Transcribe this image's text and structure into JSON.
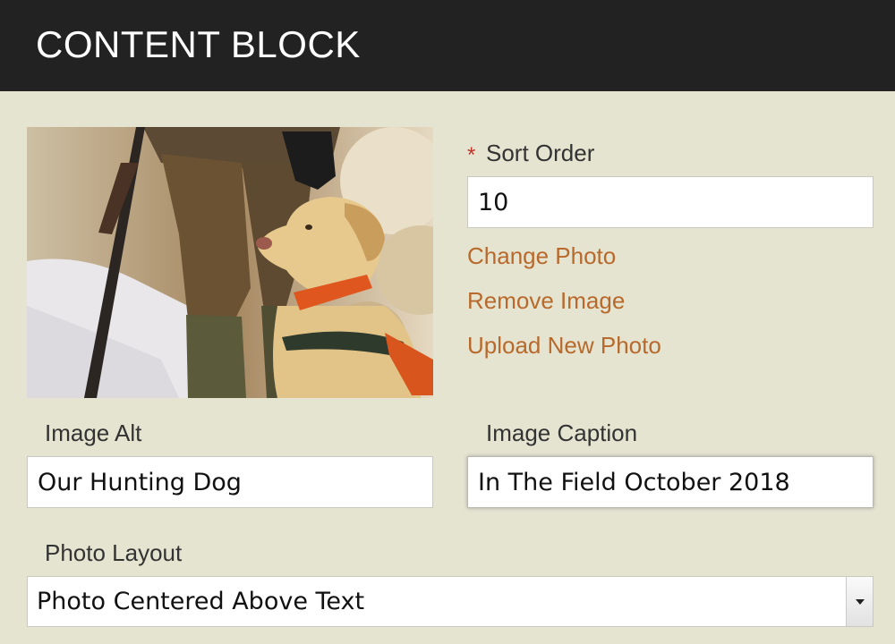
{
  "header": {
    "title": "CONTENT BLOCK"
  },
  "sort_order": {
    "required_mark": "*",
    "label": "Sort Order",
    "value": "10"
  },
  "photo_actions": {
    "change": "Change Photo",
    "remove": "Remove Image",
    "upload": "Upload New Photo"
  },
  "image_alt": {
    "label": "Image Alt",
    "value": "Our Hunting Dog"
  },
  "image_caption": {
    "label": "Image Caption",
    "value": "In The Field October 2018"
  },
  "photo_layout": {
    "label": "Photo Layout",
    "selected": "Photo Centered Above Text"
  },
  "colors": {
    "header_bg": "#222222",
    "page_bg": "#e5e4d1",
    "link": "#b8692c",
    "required": "#c0362c"
  }
}
